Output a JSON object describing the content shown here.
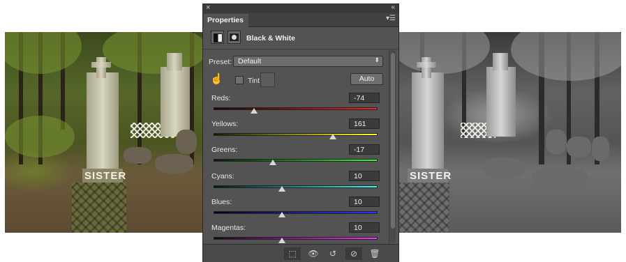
{
  "panel": {
    "tab_label": "Properties",
    "adjustment_title": "Black & White",
    "preset_label": "Preset:",
    "preset_value": "Default",
    "tint_label": "Tint",
    "auto_label": "Auto",
    "sliders": [
      {
        "label": "Reds:",
        "value": "-74",
        "position": 0.248
      },
      {
        "label": "Yellows:",
        "value": "161",
        "position": 0.727
      },
      {
        "label": "Greens:",
        "value": "-17",
        "position": 0.362
      },
      {
        "label": "Cyans:",
        "value": "10",
        "position": 0.418
      },
      {
        "label": "Blues:",
        "value": "10",
        "position": 0.418
      },
      {
        "label": "Magentas:",
        "value": "10",
        "position": 0.418
      }
    ],
    "slider_gradients": [
      [
        "#1a0505",
        "#ff2020"
      ],
      [
        "#1a1a05",
        "#ffff30"
      ],
      [
        "#051a05",
        "#33ff33"
      ],
      [
        "#051a1a",
        "#30ffff"
      ],
      [
        "#05051a",
        "#3030ff"
      ],
      [
        "#1a051a",
        "#ff30ff"
      ]
    ],
    "footer_icons": [
      "clip-to-layer-icon",
      "view-previous-state-icon",
      "reset-icon",
      "visibility-icon",
      "trash-icon"
    ]
  },
  "photos": {
    "stone_label": "SISTER"
  }
}
